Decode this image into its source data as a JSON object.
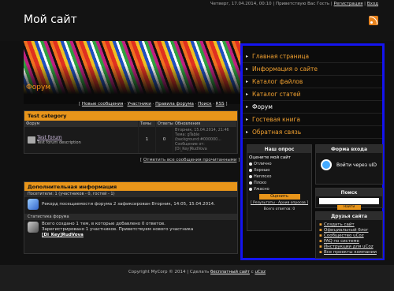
{
  "header": {
    "site_title": "Мой сайт",
    "date_time": "Четверг, 17.04.2014, 00:10",
    "greeting": "Приветствую Вас Гость",
    "register": "Регистрация",
    "login": "Вход",
    "rss_icon": "rss-icon"
  },
  "main": {
    "page_title": "Форум",
    "links": [
      "Новые сообщения",
      "Участники",
      "Правила форума",
      "Поиск",
      "RSS"
    ],
    "category": {
      "title": "Test category",
      "columns": [
        "Форум",
        "Темы",
        "Ответы",
        "Обновления"
      ],
      "forum": {
        "name": "Test forum",
        "description": "Test forum description",
        "topics": "1",
        "replies": "0",
        "last_update_date": "Вторник, 15.04.2014, 21:46",
        "last_update_topic": "Тема: gTable (background:#000000...",
        "last_update_author": "Сообщение от: [Di_Key]RudVova"
      }
    },
    "mark_read": "Отметить все сообщения прочитанными",
    "info": {
      "title": "Дополнительная информация",
      "visitors": "Посетители: 1 (участников - 0, гостей - 1)",
      "record": "Рекорд посещаемости форума 2 зафиксирован Вторник, 14:05, 15.04.2014.",
      "stats_head": "Статистика форума",
      "stats_line1": "Всего создано 1 тем, в которые добавлено 0 ответов.",
      "stats_line2": "Зарегистрировано 1 участников. Приветствуем нового участника",
      "new_member": "[Di_Key]RudVova"
    }
  },
  "sidebar": {
    "nav": [
      "Главная страница",
      "Информация о сайте",
      "Каталог файлов",
      "Каталог статей",
      "Форум",
      "Гостевая книга",
      "Обратная связь"
    ],
    "poll": {
      "title": "Наш опрос",
      "question": "Оцените мой сайт",
      "options": [
        "Отлично",
        "Хорошо",
        "Неплохо",
        "Плохо",
        "Ужасно"
      ],
      "vote_button": "Оценить",
      "results": "[ Результаты · Архив опросов ]",
      "total": "Всего ответов: 0"
    },
    "login_box": {
      "title": "Форма входа",
      "uid_text": "Войти через uID"
    },
    "search_box": {
      "title": "Поиск",
      "button": "Найти"
    },
    "friends": {
      "title": "Друзья сайта",
      "links": [
        "Создать сайт",
        "Официальный блог",
        "Сообщество uCoz",
        "FAQ по системе",
        "Инструкции для uCoz",
        "Все проекты компании"
      ]
    }
  },
  "footer": {
    "copyright": "Copyright MyCorp © 2014",
    "separator": "| Сделать",
    "free_site": "бесплатный сайт",
    "with": "с",
    "ucoz": "uCoz"
  }
}
